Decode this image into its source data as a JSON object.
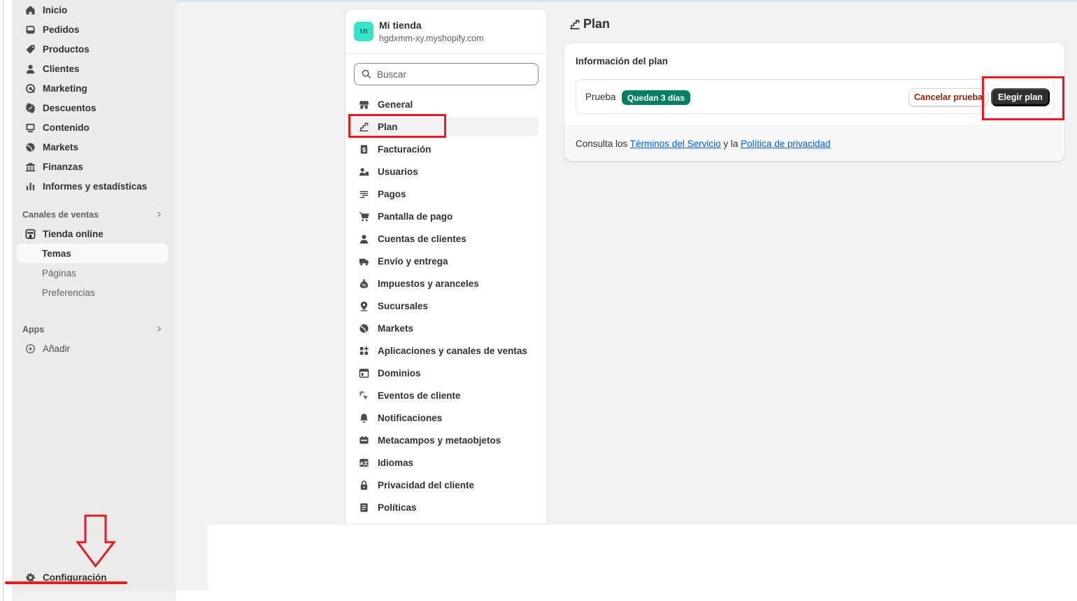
{
  "sidebar": {
    "nav": [
      {
        "label": "Inicio",
        "icon": "home-icon"
      },
      {
        "label": "Pedidos",
        "icon": "inbox-icon"
      },
      {
        "label": "Productos",
        "icon": "tag-icon"
      },
      {
        "label": "Clientes",
        "icon": "person-icon"
      },
      {
        "label": "Marketing",
        "icon": "target-icon"
      },
      {
        "label": "Descuentos",
        "icon": "discount-icon"
      },
      {
        "label": "Contenido",
        "icon": "image-icon"
      },
      {
        "label": "Markets",
        "icon": "globe-icon"
      },
      {
        "label": "Finanzas",
        "icon": "bank-icon"
      },
      {
        "label": "Informes y estadísticas",
        "icon": "chart-icon"
      }
    ],
    "sales_channels": {
      "heading": "Canales de ventas",
      "store": "Tienda online",
      "themes": "Temas",
      "pages": "Páginas",
      "preferences": "Preferencias"
    },
    "apps": {
      "heading": "Apps",
      "add": "Añadir"
    },
    "settings_label": "Configuración"
  },
  "settings_panel": {
    "store_initials": "Mt",
    "store_name": "Mi tienda",
    "store_domain": "hgdxmm-xy.myshopify.com",
    "search_placeholder": "Buscar",
    "items": [
      {
        "label": "General",
        "icon": "store-icon"
      },
      {
        "label": "Plan",
        "icon": "plan-icon",
        "active": true
      },
      {
        "label": "Facturación",
        "icon": "billing-icon"
      },
      {
        "label": "Usuarios",
        "icon": "users-icon"
      },
      {
        "label": "Pagos",
        "icon": "payments-icon"
      },
      {
        "label": "Pantalla de pago",
        "icon": "cart-icon"
      },
      {
        "label": "Cuentas de clientes",
        "icon": "person-icon"
      },
      {
        "label": "Envío y entrega",
        "icon": "truck-icon"
      },
      {
        "label": "Impuestos y aranceles",
        "icon": "tax-icon"
      },
      {
        "label": "Sucursales",
        "icon": "location-icon"
      },
      {
        "label": "Markets",
        "icon": "globe-icon"
      },
      {
        "label": "Aplicaciones y canales de ventas",
        "icon": "apps-icon"
      },
      {
        "label": "Dominios",
        "icon": "domain-icon"
      },
      {
        "label": "Eventos de cliente",
        "icon": "cursor-icon"
      },
      {
        "label": "Notificaciones",
        "icon": "bell-icon"
      },
      {
        "label": "Metacampos y metaobjetos",
        "icon": "metafield-icon"
      },
      {
        "label": "Idiomas",
        "icon": "language-icon"
      },
      {
        "label": "Privacidad del cliente",
        "icon": "lock-icon"
      },
      {
        "label": "Políticas",
        "icon": "policy-icon"
      }
    ]
  },
  "plan_page": {
    "title": "Plan",
    "card_heading": "Información del plan",
    "plan_label": "Prueba",
    "badge": "Quedan 3 días",
    "cancel_button": "Cancelar prueba",
    "choose_button": "Elegir plan",
    "footer_prefix": "Consulta los ",
    "terms_link": "Términos del Servicio",
    "footer_and": " y la ",
    "privacy_link": "Política de privacidad"
  },
  "colors": {
    "accent_green": "#008060",
    "annotation_red": "#e31c23",
    "link_blue": "#005bd3"
  }
}
